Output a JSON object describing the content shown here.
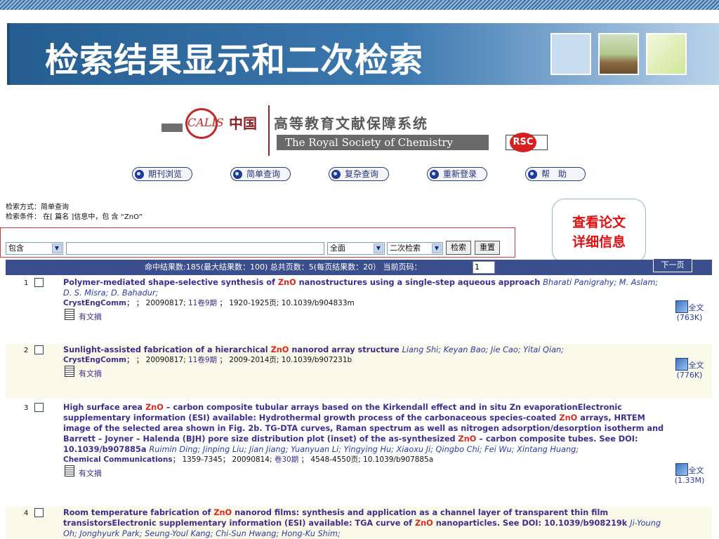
{
  "slide": {
    "title": "检索结果显示和二次检索"
  },
  "logo": {
    "mark": "CALIS",
    "cn": "中国",
    "big": "高等教育文献保障系统",
    "en": "The Royal Society of Chemistry",
    "rsc": "RSC"
  },
  "nav": [
    "期刊浏览",
    "简单查询",
    "复杂查询",
    "重新登录",
    "帮　助"
  ],
  "search_info": {
    "mode": "检索方式：简单查询",
    "cond": "检索条件：  在[ 篇名 ]信息中，包 含 “ZnO”"
  },
  "callout": {
    "line1": "查看论文",
    "line2": "详细信息"
  },
  "form": {
    "op": "包含",
    "scope": "全面",
    "mode": "二次检索",
    "search_btn": "检索",
    "reset_btn": "重置",
    "input_value": ""
  },
  "results_bar": {
    "summary": "命中结果数:185(最大结果数：100)  总共页数：5(每页结果数：20）  当前页码：",
    "page": "1",
    "next": "下一页"
  },
  "results": [
    {
      "num": "1",
      "title_parts": [
        "Polymer-mediated shape-selective synthesis of ",
        "ZnO",
        " nanostructures using a single-step aqueous approach "
      ],
      "authors": "Bharati Panigrahy; M. Aslam; D. S. Misra; D. Bahadur;",
      "journal": "CrystEngComm",
      "source_mid": "；  ；  20090817; ",
      "vol": "11卷9期",
      "source_end": "  ；  1920-1925页; 10.1039/b904833m",
      "abstract": "有文摘",
      "fulltext": "全文",
      "size": "(763K)"
    },
    {
      "num": "2",
      "title_parts": [
        "Sunlight-assisted fabrication of a hierarchical ",
        "ZnO",
        " nanorod array structure "
      ],
      "authors": "Liang Shi; Keyan Bao; Jie Cao; Yitai Qian;",
      "journal": "CrystEngComm",
      "source_mid": "；  ；  20090817; ",
      "vol": "11卷9期",
      "source_end": "  ；  2009-2014页; 10.1039/b907231b",
      "abstract": "有文摘",
      "fulltext": "全文",
      "size": "(776K)"
    },
    {
      "num": "3",
      "title_parts": [
        "High surface area ",
        "ZnO",
        " – carbon composite tubular arrays based on the Kirkendall effect and in situ Zn evaporationElectronic supplementary information (ESI) available: Hydrothermal growth process of the carbonaceous species-coated ",
        "ZnO",
        " arrays, HRTEM image of the selected area shown in Fig. 2b. TG-DTA curves, Raman spectrum as well as nitrogen adsorption/desorption isotherm and Barrett – Joyner – Halenda (BJH) pore size distribution plot (inset) of the as-synthesized ",
        "ZnO",
        " – carbon composite tubes. See DOI: 10.1039/b907885a "
      ],
      "authors": "Ruimin Ding; Jinping Liu; Jian Jiang; Yuanyuan Li; Yingying Hu; Xiaoxu Ji; Qingbo Chi; Fei Wu; Xintang Huang;",
      "journal": "Chemical Communications",
      "source_mid": "；  1359-7345；  20090814; ",
      "vol": "卷30期",
      "source_end": "  ；  4548-4550页; 10.1039/b907885a",
      "abstract": "有文摘",
      "fulltext": "全文",
      "size": "(1.33M)"
    },
    {
      "num": "4",
      "title_parts": [
        "Room temperature fabrication of ",
        "ZnO",
        " nanorod films: synthesis and application as a channel layer of transparent thin film transistorsElectronic supplementary information (ESI) available: TGA curve of ",
        "ZnO",
        " nanoparticles. See DOI: 10.1039/b908219k "
      ],
      "authors": "Ji-Young Oh; Jonghyurk Park; Seung-Youl Kang; Chi-Sun Hwang; Hong-Ku Shim;",
      "journal": "",
      "source_mid": "",
      "vol": "",
      "source_end": "",
      "abstract": "",
      "fulltext": "",
      "size": ""
    }
  ]
}
